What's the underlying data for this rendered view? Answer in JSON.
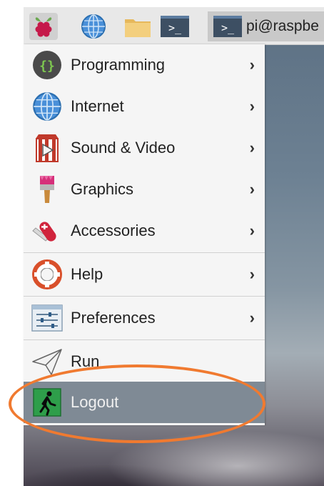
{
  "taskbar": {
    "launchers": [
      {
        "icon": "raspberry-menu-icon"
      },
      {
        "icon": "globe-icon"
      },
      {
        "icon": "folder-icon"
      },
      {
        "icon": "terminal-icon"
      }
    ],
    "task": {
      "icon": "terminal-icon",
      "label": "pi@raspbe",
      "prompt_glyph": ">_"
    }
  },
  "menu": {
    "items": [
      {
        "label": "Programming",
        "icon": "programming-icon",
        "submenu": true
      },
      {
        "label": "Internet",
        "icon": "globe-icon",
        "submenu": true
      },
      {
        "label": "Sound & Video",
        "icon": "sound-video-icon",
        "submenu": true
      },
      {
        "label": "Graphics",
        "icon": "paintbrush-icon",
        "submenu": true
      },
      {
        "label": "Accessories",
        "icon": "accessories-icon",
        "submenu": true
      },
      {
        "label": "Help",
        "icon": "lifebuoy-icon",
        "submenu": true
      },
      {
        "label": "Preferences",
        "icon": "preferences-icon",
        "submenu": true
      },
      {
        "label": "Run",
        "icon": "paper-plane-icon",
        "submenu": false
      },
      {
        "label": "Logout",
        "icon": "exit-icon",
        "submenu": false,
        "highlighted": true
      }
    ],
    "arrow_glyph": "›"
  },
  "annotation": {
    "shape": "ellipse",
    "color": "#f07a30",
    "target": "Logout"
  }
}
